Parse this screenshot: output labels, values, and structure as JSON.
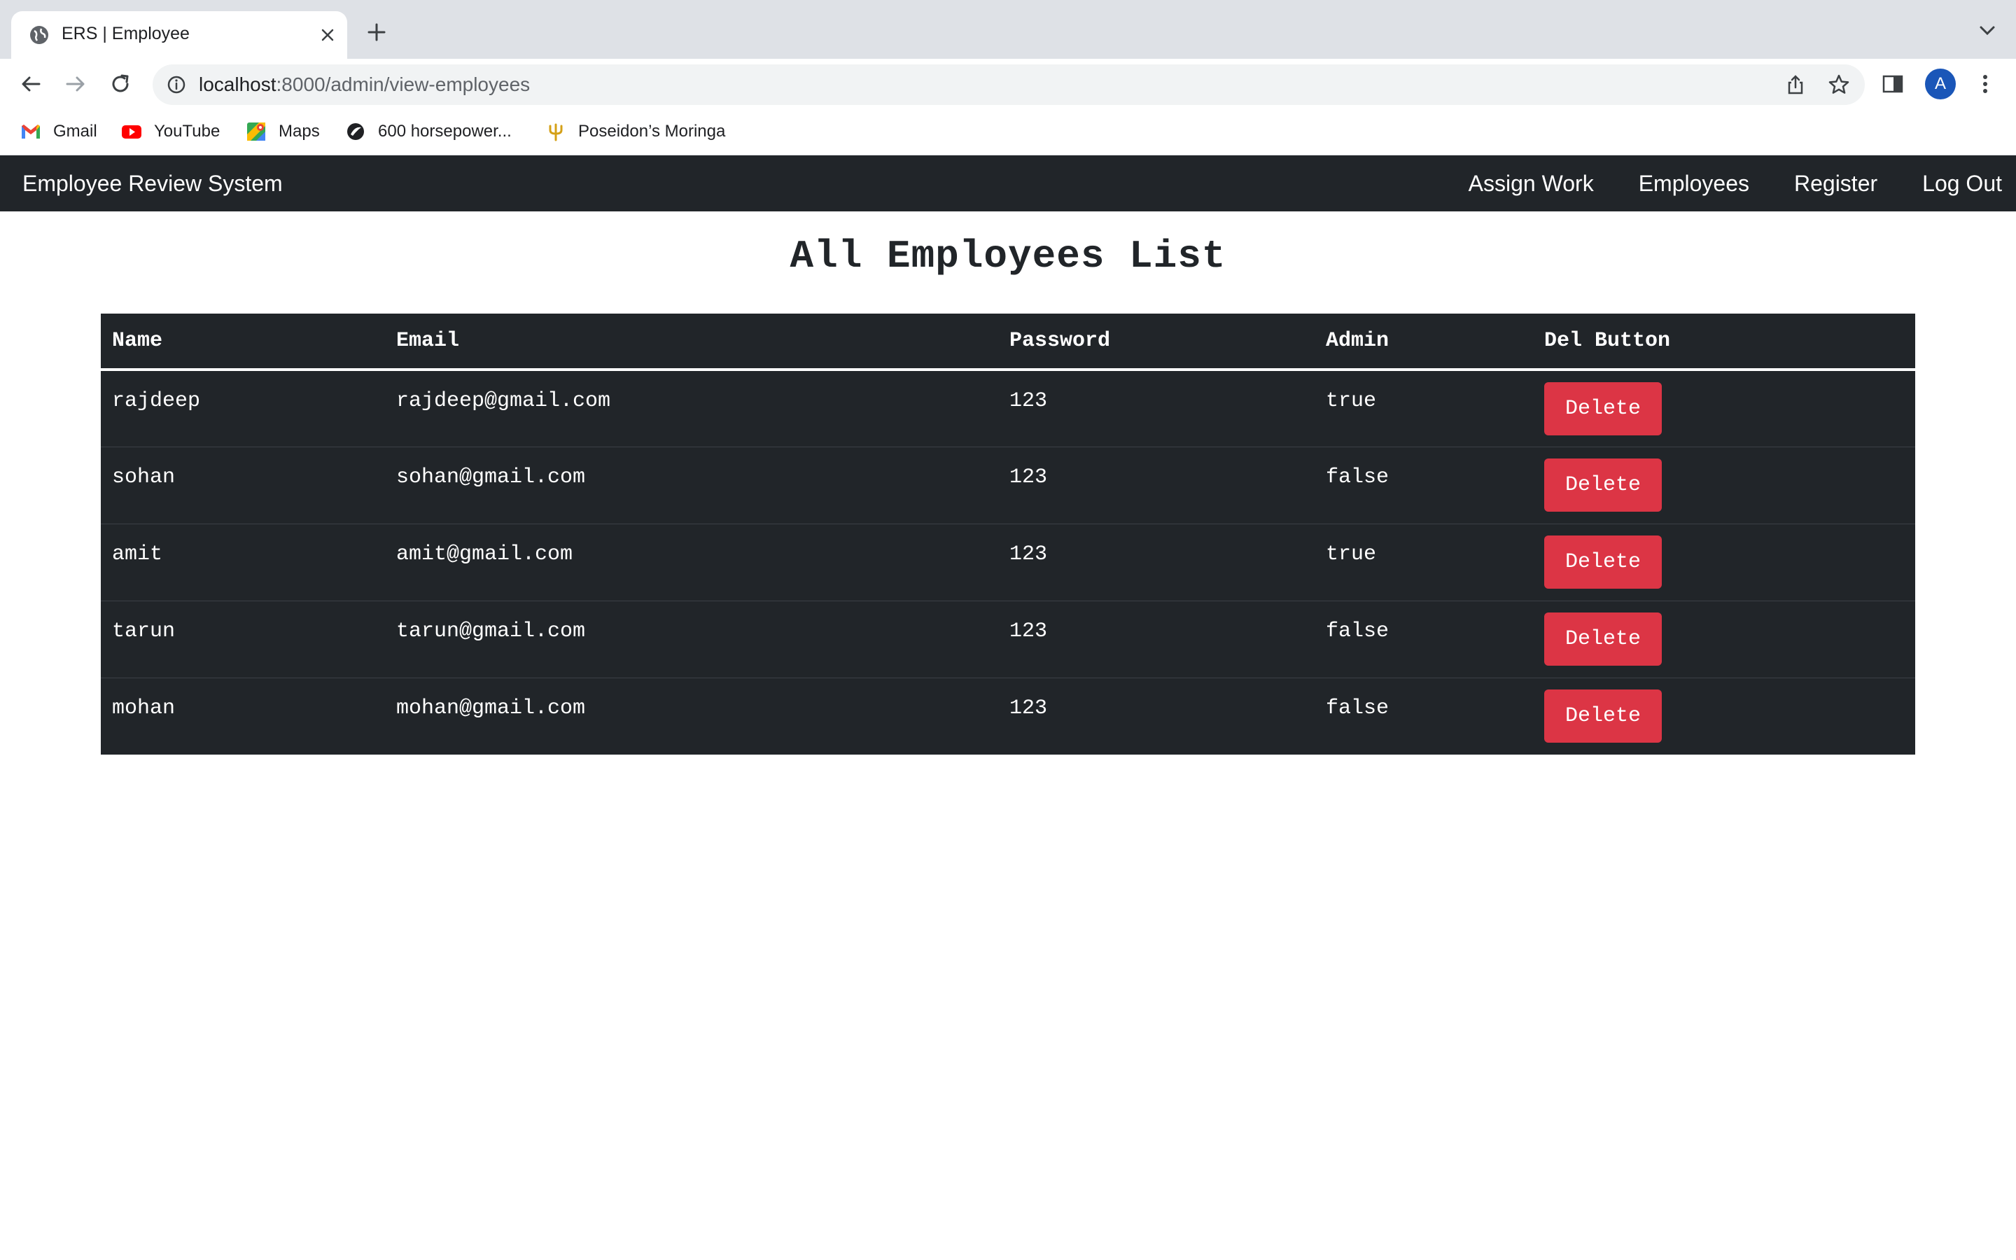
{
  "browser": {
    "tab_title": "ERS | Employee",
    "url_host": "localhost",
    "url_path": ":8000/admin/view-employees",
    "avatar_letter": "A",
    "bookmarks": [
      {
        "label": "Gmail",
        "icon": "gmail-icon"
      },
      {
        "label": "YouTube",
        "icon": "youtube-icon"
      },
      {
        "label": "Maps",
        "icon": "maps-icon"
      },
      {
        "label": "600 horsepower...",
        "icon": "site-icon"
      },
      {
        "label": "Poseidon’s Moringa",
        "icon": "trident-icon"
      }
    ]
  },
  "navbar": {
    "brand": "Employee Review System",
    "links": [
      "Assign Work",
      "Employees",
      "Register",
      "Log Out"
    ]
  },
  "page": {
    "title": "All Employees List"
  },
  "table": {
    "headers": [
      "Name",
      "Email",
      "Password",
      "Admin",
      "Del Button"
    ],
    "rows": [
      {
        "name": "rajdeep",
        "email": "rajdeep@gmail.com",
        "password": "123",
        "admin": "true",
        "action": "Delete"
      },
      {
        "name": "sohan",
        "email": "sohan@gmail.com",
        "password": "123",
        "admin": "false",
        "action": "Delete"
      },
      {
        "name": "amit",
        "email": "amit@gmail.com",
        "password": "123",
        "admin": "true",
        "action": "Delete"
      },
      {
        "name": "tarun",
        "email": "tarun@gmail.com",
        "password": "123",
        "admin": "false",
        "action": "Delete"
      },
      {
        "name": "mohan",
        "email": "mohan@gmail.com",
        "password": "123",
        "admin": "false",
        "action": "Delete"
      }
    ]
  },
  "colors": {
    "navbar_bg": "#212529",
    "table_bg": "#212529",
    "delete_button": "#dc3545",
    "tabstrip_bg": "#dee1e6"
  }
}
